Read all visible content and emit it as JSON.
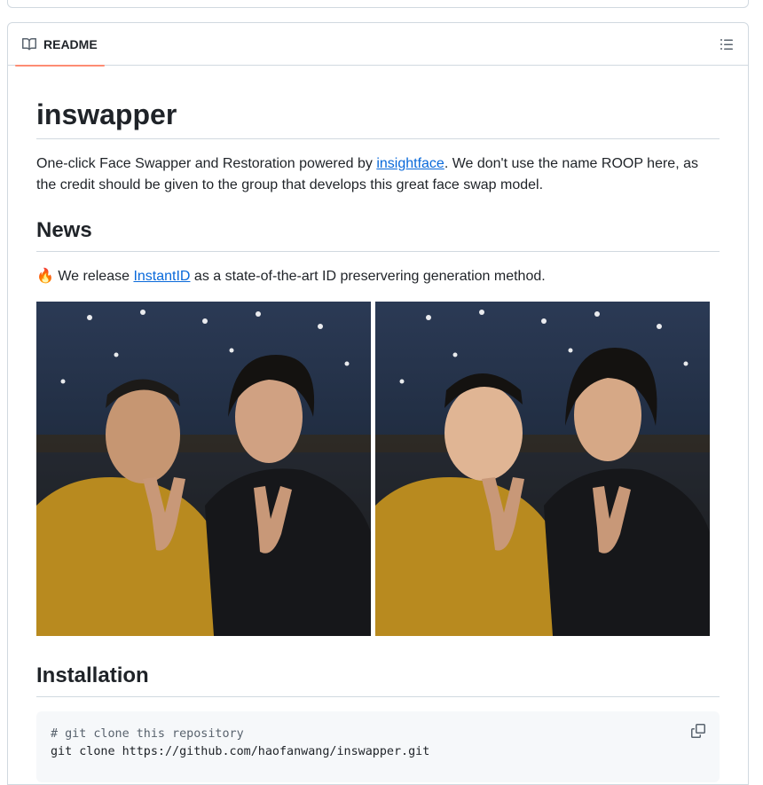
{
  "readme": {
    "tab_label": "README",
    "tab_icon": "book-icon",
    "outline_icon": "list-unordered-icon"
  },
  "article": {
    "title": "inswapper",
    "intro": {
      "before": "One-click Face Swapper and Restoration powered by ",
      "link": "insightface",
      "after": ". We don't use the name ROOP here, as the credit should be given to the group that develops this great face swap model."
    },
    "news": {
      "heading": "News",
      "emoji": "🔥",
      "before": " We release ",
      "link": "InstantID",
      "after": " as a state-of-the-art ID preservering generation method."
    },
    "installation": {
      "heading": "Installation",
      "comment": "# git clone this repository",
      "command": "git clone https://github.com/haofanwang/inswapper.git",
      "copy_icon": "copy-icon"
    }
  },
  "colors": {
    "accent_underline": "#fd8c73",
    "link": "#0969da",
    "border": "#d1d9e0",
    "code_bg": "#f6f8fa"
  }
}
